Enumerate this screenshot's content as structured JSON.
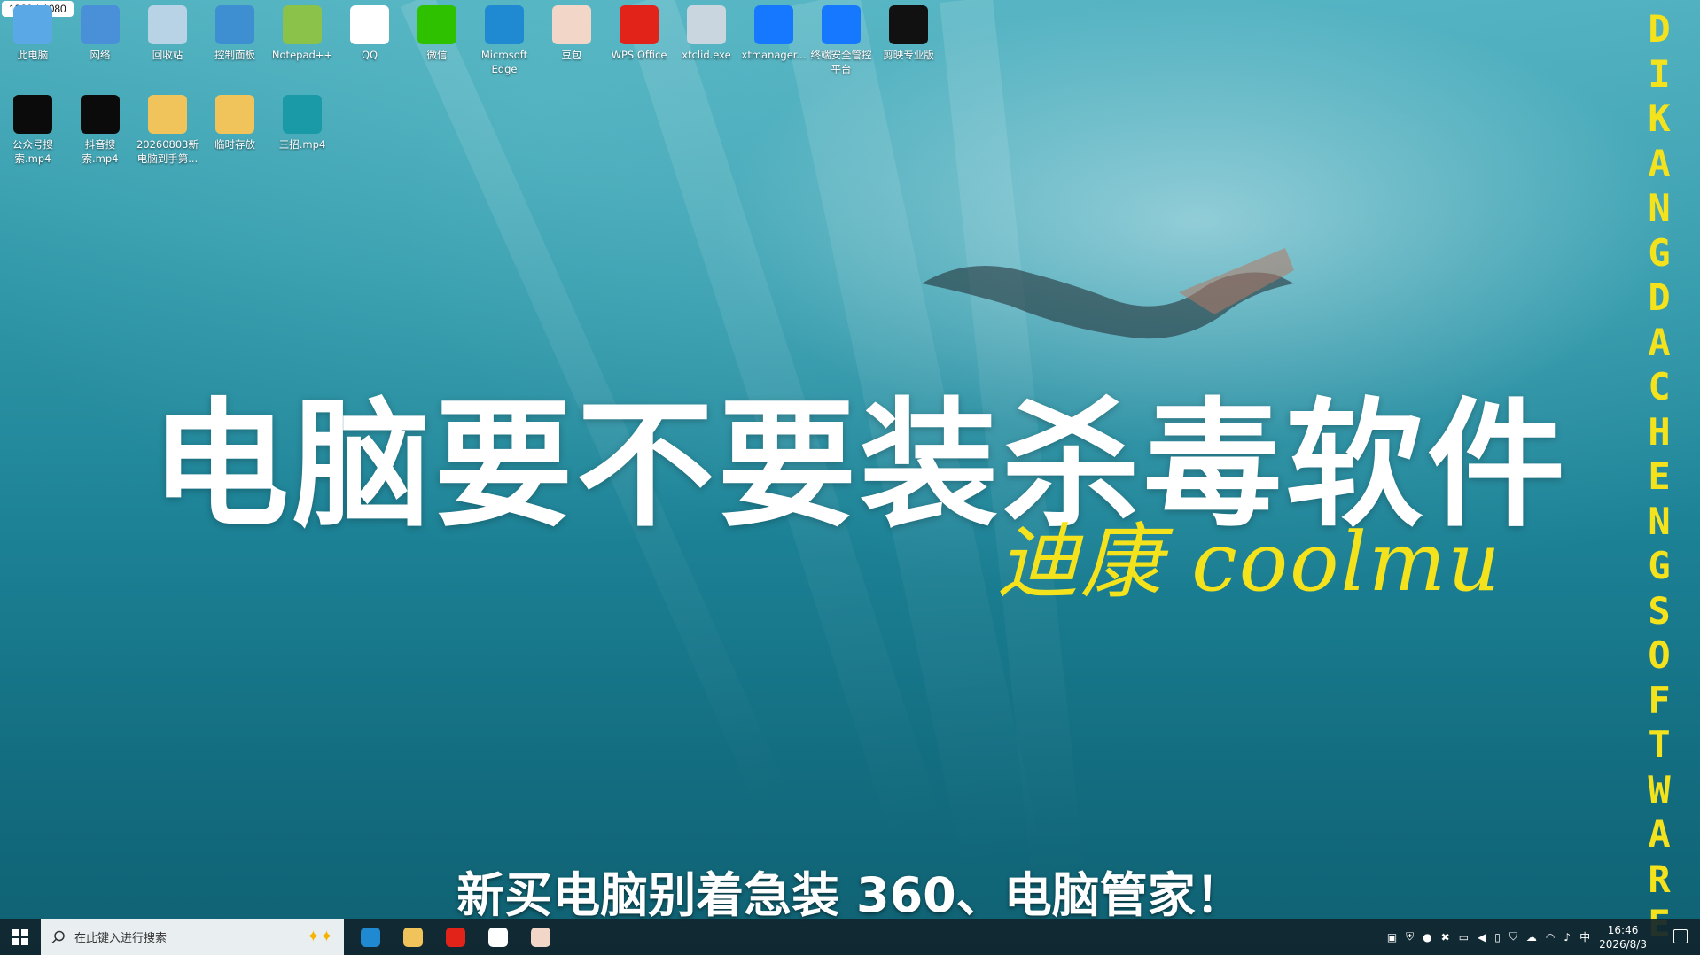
{
  "resolution_badge": "1920 * 1080",
  "desktop_icons_row1": [
    {
      "label": "此电脑",
      "icon": "computer-icon",
      "color": "#5aa9e6"
    },
    {
      "label": "网络",
      "icon": "network-icon",
      "color": "#4a90d9"
    },
    {
      "label": "回收站",
      "icon": "recycle-bin-icon",
      "color": "#b9d3e6"
    },
    {
      "label": "控制面板",
      "icon": "control-panel-icon",
      "color": "#3d8fd1"
    },
    {
      "label": "Notepad++",
      "icon": "notepad-plus-plus-icon",
      "color": "#8bc34a"
    },
    {
      "label": "QQ",
      "icon": "qq-penguin-icon",
      "color": "#ffffff"
    },
    {
      "label": "微信",
      "icon": "wechat-icon",
      "color": "#2dc100"
    },
    {
      "label": "Microsoft Edge",
      "icon": "edge-icon",
      "color": "#1f8ad2"
    },
    {
      "label": "豆包",
      "icon": "doubao-avatar-icon",
      "color": "#f2d7c9"
    },
    {
      "label": "WPS Office",
      "icon": "wps-icon",
      "color": "#e2231a"
    },
    {
      "label": "xtclid.exe",
      "icon": "xtclid-icon",
      "color": "#c9d6e0"
    },
    {
      "label": "xtmanager...",
      "icon": "xtmanager-shield-icon",
      "color": "#1677ff"
    },
    {
      "label": "终端安全管控平台",
      "icon": "terminal-security-shield-icon",
      "color": "#1677ff"
    },
    {
      "label": "剪映专业版",
      "icon": "capcut-icon",
      "color": "#111111"
    }
  ],
  "desktop_icons_row2": [
    {
      "label": "公众号搜索.mp4",
      "icon": "video-file-icon",
      "color": "#0b0b0b"
    },
    {
      "label": "抖音搜索.mp4",
      "icon": "video-file-icon",
      "color": "#0b0b0b"
    },
    {
      "label": "20260803新电脑到手第...",
      "icon": "folder-icon",
      "color": "#f0c45a"
    },
    {
      "label": "临时存放",
      "icon": "folder-icon",
      "color": "#f0c45a"
    },
    {
      "label": "三招.mp4",
      "icon": "video-file-icon",
      "color": "#1a9aa6"
    }
  ],
  "title": "电脑要不要装杀毒软件",
  "signature": "迪康 coolmu",
  "vertical_text": "DIKANG DACHENG SOFTWARE",
  "subtitle": "新买电脑别着急装 360、电脑管家！",
  "taskbar": {
    "search_placeholder": "在此键入进行搜索",
    "apps": [
      {
        "icon": "edge-icon",
        "color": "#1f8ad2"
      },
      {
        "icon": "file-explorer-icon",
        "color": "#f0c45a"
      },
      {
        "icon": "wps-icon",
        "color": "#e2231a"
      },
      {
        "icon": "qq-penguin-icon",
        "color": "#ffffff"
      },
      {
        "icon": "doubao-avatar-icon",
        "color": "#f2d7c9"
      }
    ],
    "ime": "中",
    "time": "16:46",
    "date": "2026/8/3"
  },
  "colors": {
    "accent_yellow": "#f4e21c"
  }
}
